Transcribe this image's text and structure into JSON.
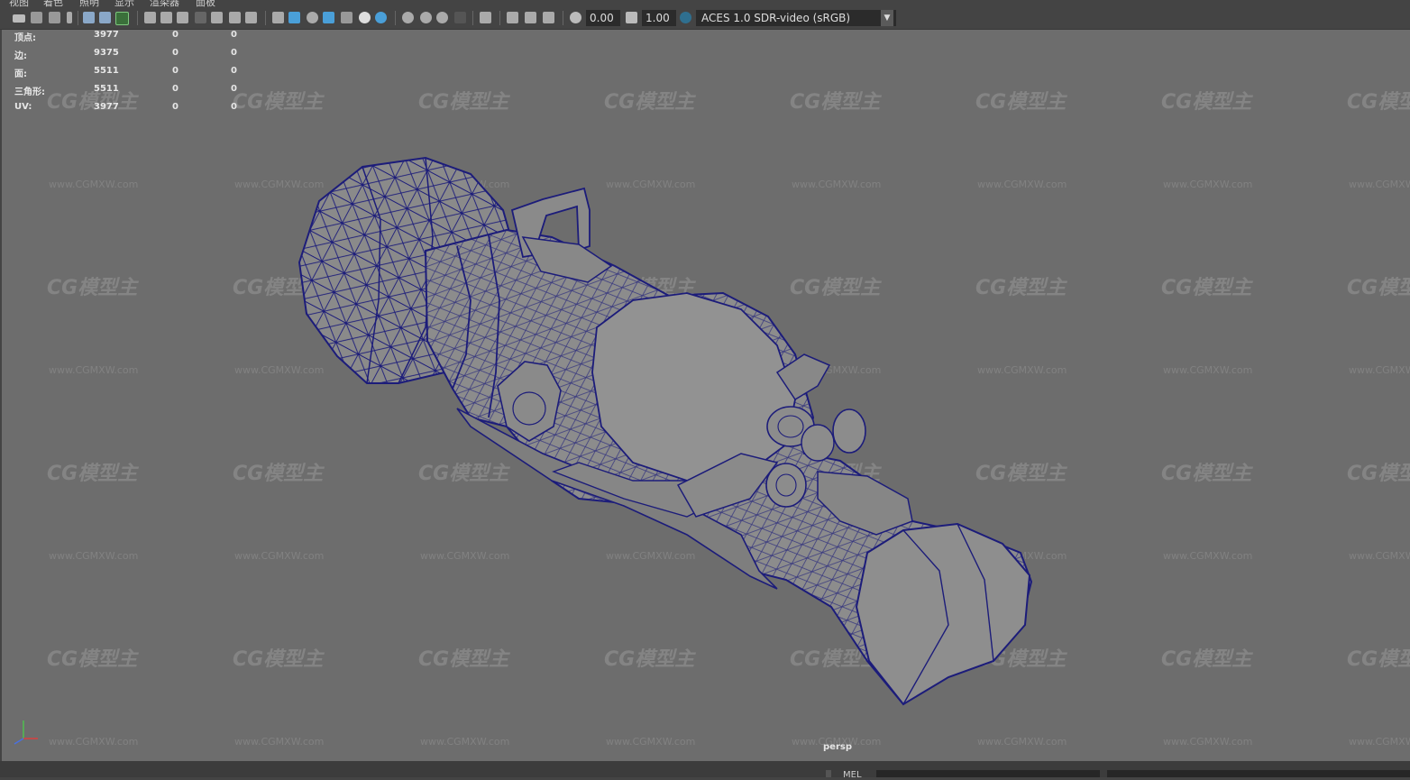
{
  "menubar": {
    "items": [
      "视图",
      "着色",
      "照明",
      "显示",
      "渲染器",
      "面板"
    ]
  },
  "toolbar": {
    "exposure_value": "0.00",
    "gamma_value": "1.00",
    "color_space": "ACES 1.0 SDR-video (sRGB)",
    "accent_color": "#4a9fd8"
  },
  "hud": {
    "rows": [
      {
        "label": "顶点:",
        "count": "3977",
        "sel": "0",
        "comp": "0"
      },
      {
        "label": "边:",
        "count": "9375",
        "sel": "0",
        "comp": "0"
      },
      {
        "label": "面:",
        "count": "5511",
        "sel": "0",
        "comp": "0"
      },
      {
        "label": "三角形:",
        "count": "5511",
        "sel": "0",
        "comp": "0"
      },
      {
        "label": "UV:",
        "count": "3977",
        "sel": "0",
        "comp": "0"
      }
    ]
  },
  "viewport": {
    "camera_label": "persp",
    "background_color": "#6d6d6d",
    "wireframe_color": "#1c1c7a",
    "mesh_color": "#8a8a8a"
  },
  "watermark": {
    "logo_text": "CG模型主",
    "url_text": "www.CGMXW.com"
  },
  "bottom": {
    "label": "MEL"
  }
}
